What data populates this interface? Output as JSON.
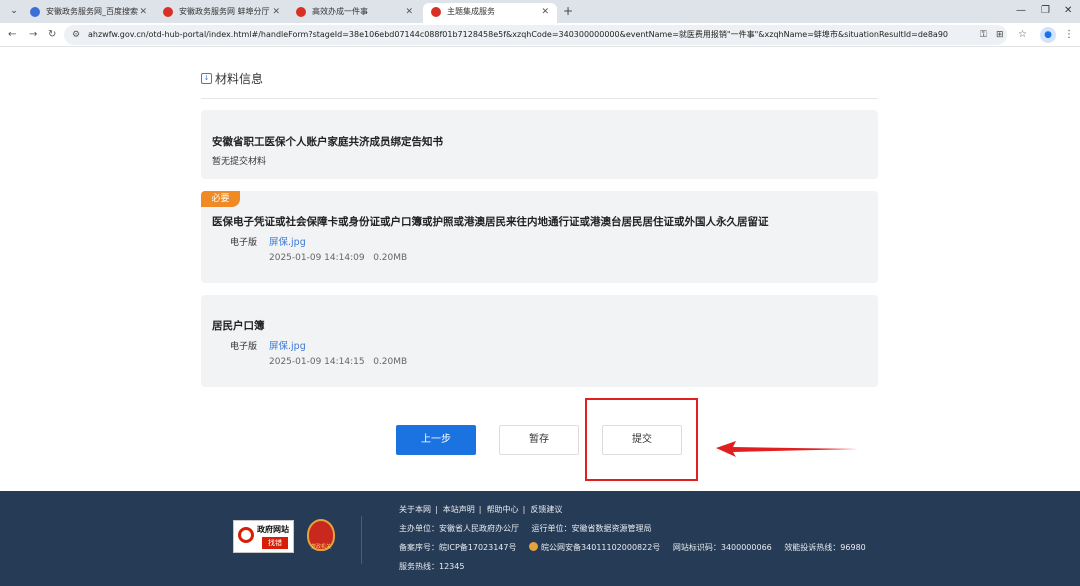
{
  "browser": {
    "tabs": [
      {
        "title": "安徽政务服务网_百度搜索",
        "favicon": "baidu-icon"
      },
      {
        "title": "安徽政务服务网 蚌埠分厅",
        "favicon": "gov-icon"
      },
      {
        "title": "高效办成一件事",
        "favicon": "gov-icon"
      },
      {
        "title": "主题集成服务",
        "favicon": "gov-icon",
        "active": true
      }
    ],
    "url": "ahzwfw.gov.cn/otd-hub-portal/index.html#/handleForm?stageId=38e106ebd07144c088f01b7128458e5f&xzqhCode=340300000000&eventName=就医费用报销\"一件事\"&xzqhName=蚌埠市&situationResultId=de8a909b098b425c900..."
  },
  "section": {
    "title": "材料信息"
  },
  "materials": [
    {
      "required": false,
      "title": "安徽省职工医保个人账户家庭共济成员绑定告知书",
      "note": "暂无提交材料"
    },
    {
      "required": true,
      "badge": "必要",
      "title": "医保电子凭证或社会保障卡或身份证或户口簿或护照或港澳居民来往内地通行证或港澳台居民居住证或外国人永久居留证",
      "file_type": "电子版",
      "file_name": "屏保.jpg",
      "file_time": "2025-01-09 14:14:09",
      "file_size": "0.20MB"
    },
    {
      "required": false,
      "title": "居民户口簿",
      "file_type": "电子版",
      "file_name": "屏保.jpg",
      "file_time": "2025-01-09 14:14:15",
      "file_size": "0.20MB"
    }
  ],
  "actions": {
    "prev": "上一步",
    "save": "暂存",
    "submit": "提交"
  },
  "annotation_colors": {
    "box": "#e02020",
    "arrow": "#e02020"
  },
  "footer": {
    "logo_text_1": "政府网站",
    "logo_text_2": "找错",
    "emblem_text": "党政机关",
    "links": [
      "关于本网",
      "本站声明",
      "帮助中心",
      "反馈建议"
    ],
    "host": "主办单位：安徽省人民政府办公厅",
    "operator": "运行单位：安徽省数据资源管理局",
    "icp": "备案序号：皖ICP备17023147号",
    "police": "皖公网安备34011102000822号",
    "site_code": "网站标识码：3400000066",
    "complaint": "效能投诉热线：96980",
    "hotline": "服务热线：12345"
  }
}
